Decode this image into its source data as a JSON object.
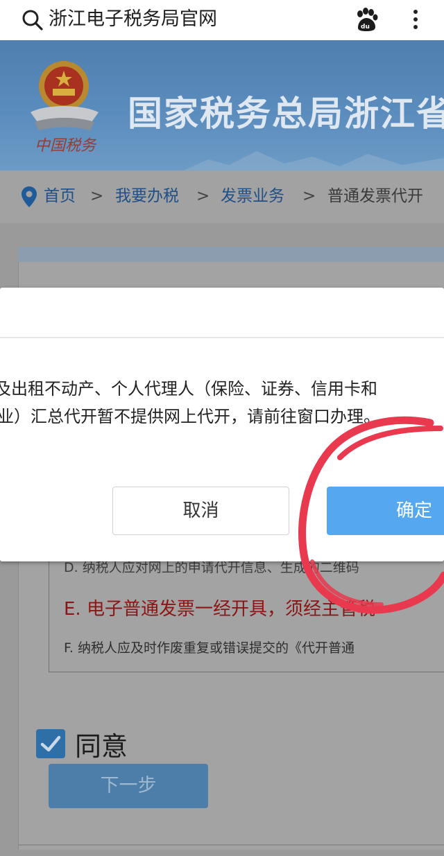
{
  "browser": {
    "title": "浙江电子税务局官网"
  },
  "banner": {
    "title": "国家税务总局浙江省",
    "seal_text": "中国税务"
  },
  "breadcrumb": {
    "items": [
      "首页",
      "我要办税",
      "发票业务",
      "普通发票代开"
    ],
    "separator": ">"
  },
  "terms": {
    "d": "D. 纳税人应对网上的申请代开信息、生成的二维码",
    "e": "E. 电子普通发票一经开具，须经主管税",
    "f": "F. 纳税人应及时作废重复或错误提交的《代开普通"
  },
  "agree": {
    "label": "同意",
    "checked": true
  },
  "next_button": {
    "label": "下一步"
  },
  "modal": {
    "line1": "及出租不动产、个人代理人（保险、证券、信用卡和",
    "line2": "业）汇总代开暂不提供网上代开，请前往窗口办理。",
    "cancel_label": "取消",
    "confirm_label": "确定"
  },
  "colors": {
    "confirm": "#55a8ef",
    "annotation": "#e8394f",
    "link": "#1f4f86"
  }
}
